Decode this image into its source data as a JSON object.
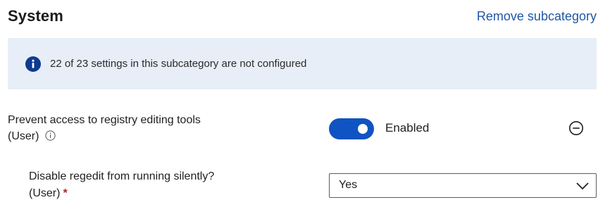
{
  "section": {
    "title": "System",
    "remove_label": "Remove subcategory"
  },
  "banner": {
    "icon": "info-icon",
    "text": "22 of 23 settings in this subcategory are not configured",
    "background": "#e7eef8",
    "icon_color": "#0f3a8f"
  },
  "setting": {
    "label_line1": "Prevent access to registry editing tools",
    "label_line2": "(User)",
    "info_icon": "info-circle-icon",
    "toggle_state": "on",
    "toggle_color": "#0f54c2",
    "toggle_label": "Enabled",
    "remove_icon": "minus-circle-icon"
  },
  "sub_setting": {
    "label_line1": "Disable regedit from running silently?",
    "label_line2": "(User)",
    "required_marker": "*",
    "dropdown_value": "Yes",
    "dropdown_icon": "chevron-down-icon"
  },
  "colors": {
    "link": "#2057a5",
    "required": "#a4262c"
  }
}
